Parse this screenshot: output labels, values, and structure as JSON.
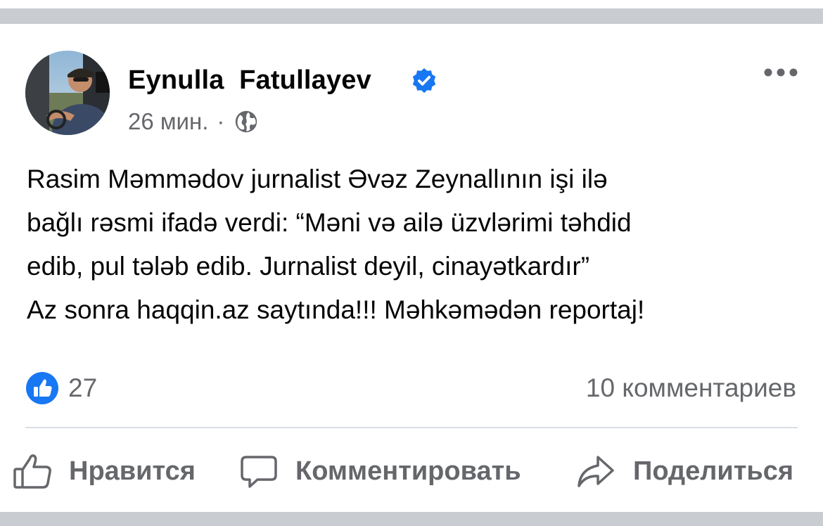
{
  "post": {
    "author": {
      "name": "Eynulla  Fatullayev",
      "verified": true,
      "avatar_icon": "profile-photo-avatar"
    },
    "time": "26 мин.",
    "separator": "·",
    "privacy_icon": "globe-icon",
    "more_icon": "more-horizontal-icon",
    "text_lines": [
      "Rasim Məmmədov jurnalist Əvəz Zeynallının işi ilə",
      "bağlı rəsmi ifadə verdi: “Məni və ailə üzvlərimi təhdid",
      "edib, pul tələb edib. Jurnalist deyil, cinayətkardır”",
      "Az sonra haqqin.az saytında!!! Məhkəmədən reportaj!"
    ],
    "reactions": {
      "icon": "like-reaction-icon",
      "count": "27"
    },
    "comments_count_label": "10 комментариев",
    "actions": {
      "like": "Нравится",
      "comment": "Комментировать",
      "share": "Поделиться"
    }
  },
  "colors": {
    "brand_blue": "#1877f2",
    "secondary_text": "#65676b",
    "primary_text": "#050505",
    "divider": "#dadde1",
    "band": "#c9ccd1"
  }
}
